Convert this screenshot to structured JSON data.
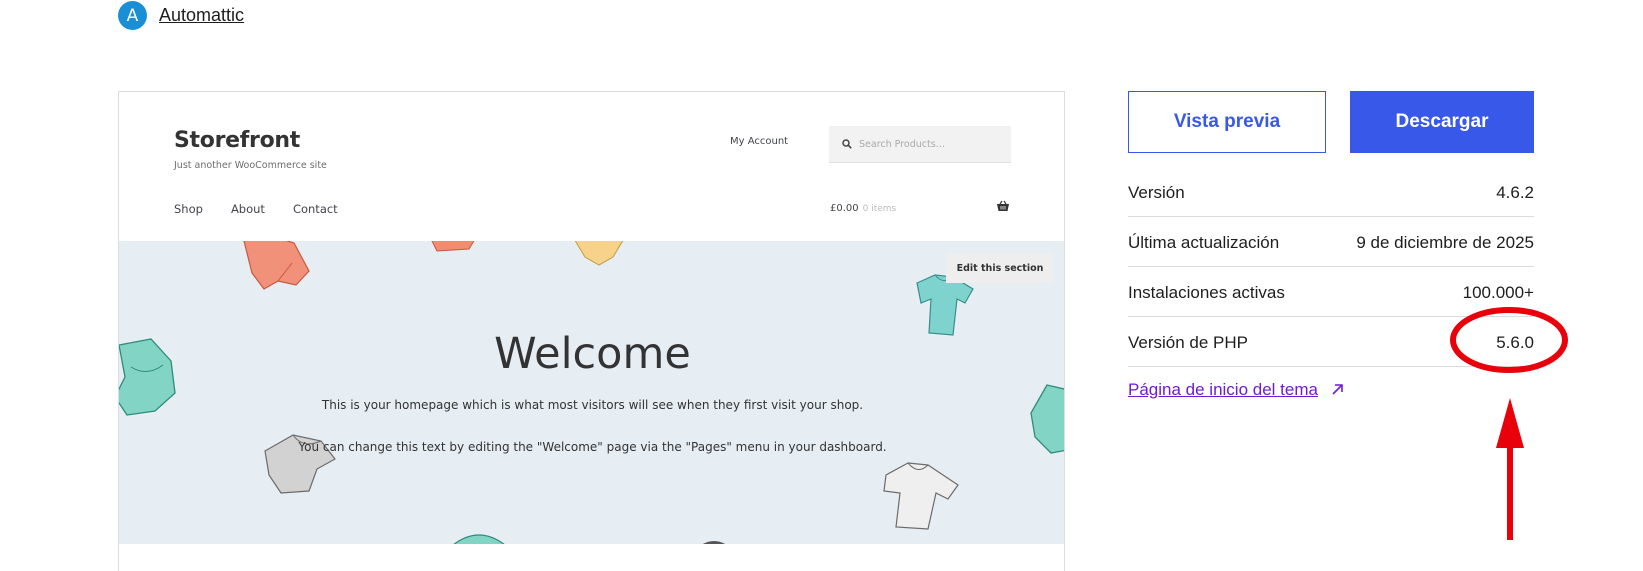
{
  "author": {
    "avatar_letter": "A",
    "name": "Automattic",
    "avatar_color": "#1a8fd6"
  },
  "preview": {
    "site_title": "Storefront",
    "tagline": "Just another WooCommerce site",
    "my_account": "My Account",
    "search_placeholder": "Search Products…",
    "nav": [
      "Shop",
      "About",
      "Contact"
    ],
    "cart_total": "£0.00",
    "cart_items": "0 items",
    "edit_section": "Edit this section",
    "hero_title": "Welcome",
    "hero_text_1": "This is your homepage which is what most visitors will see when they first visit your shop.",
    "hero_text_2": "You can change this text by editing the \"Welcome\" page via the \"Pages\" menu in your dashboard.",
    "hero_bg_color": "#e6edf3"
  },
  "actions": {
    "preview_label": "Vista previa",
    "download_label": "Descargar",
    "accent_color": "#3858e9"
  },
  "meta": [
    {
      "label": "Versión",
      "value": "4.6.2"
    },
    {
      "label": "Última actualización",
      "value": "9 de diciembre de 2025"
    },
    {
      "label": "Instalaciones activas",
      "value": "100.000+"
    },
    {
      "label": "Versión de PHP",
      "value": "5.6.0"
    }
  ],
  "homepage_link": "Página de inicio del tema",
  "annotation_color": "#e8000b"
}
